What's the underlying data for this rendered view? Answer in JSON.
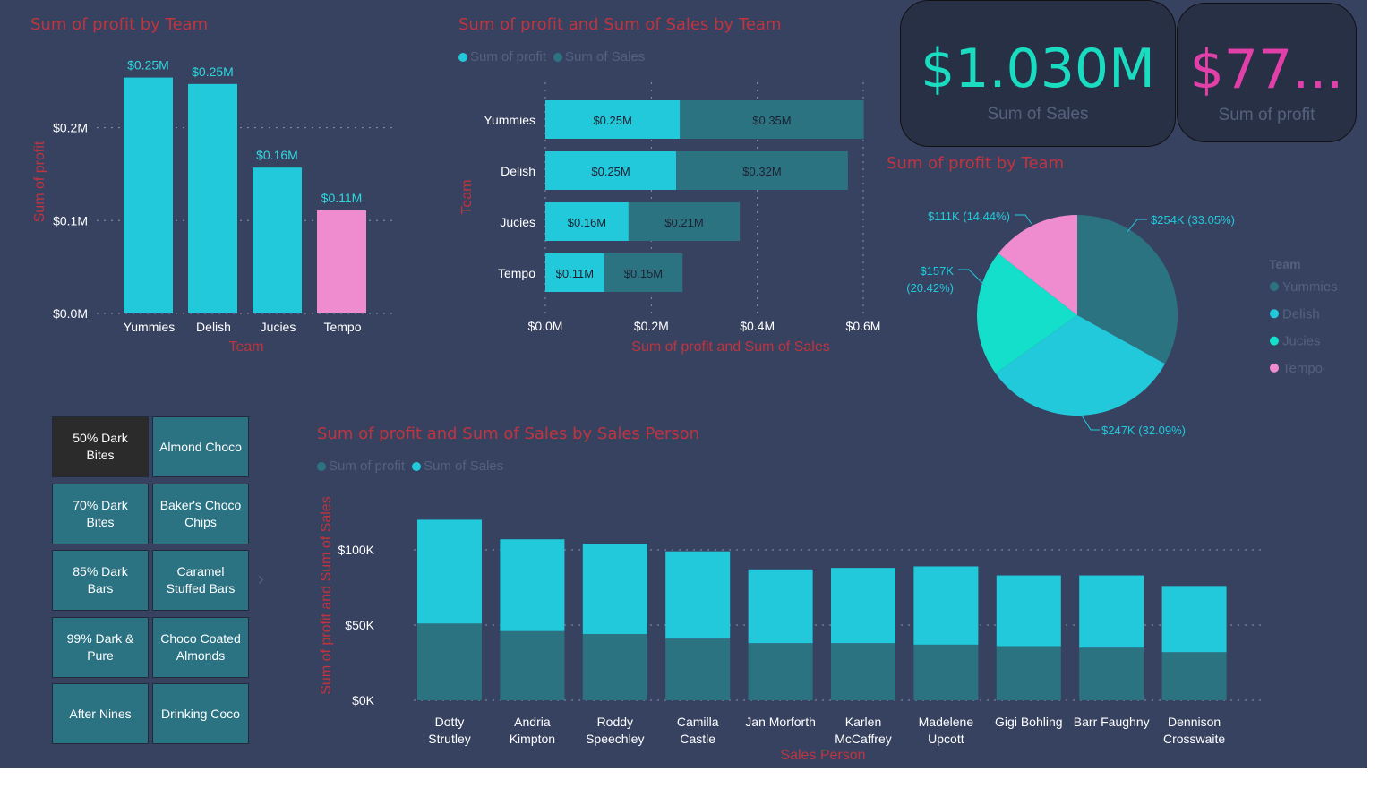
{
  "colors": {
    "cyan": "#22c9db",
    "teal": "#2c7382",
    "aqua": "#14dfcb",
    "pink": "#ee8ccf",
    "title": "#c0343f",
    "muted": "#55617c"
  },
  "cards": {
    "sales": {
      "value": "$1.030M",
      "label": "Sum of Sales",
      "color": "#19dcc0"
    },
    "profit": {
      "value": "$77...",
      "label": "Sum of profit",
      "color": "#e040a8"
    }
  },
  "slicer": {
    "items": [
      "50% Dark Bites",
      "Almond Choco",
      "70% Dark Bites",
      "Baker's Choco Chips",
      "85% Dark Bars",
      "Caramel Stuffed Bars",
      "99% Dark & Pure",
      "Choco Coated Almonds",
      "After Nines",
      "Drinking Coco"
    ],
    "selected": "50% Dark Bites"
  },
  "chart_data": [
    {
      "type": "bar",
      "title": "Sum of profit by Team",
      "xlabel": "Team",
      "ylabel": "Sum of profit",
      "categories": [
        "Yummies",
        "Delish",
        "Jucies",
        "Tempo"
      ],
      "values": [
        0.254,
        0.247,
        0.157,
        0.111
      ],
      "data_labels": [
        "$0.25M",
        "$0.25M",
        "$0.16M",
        "$0.11M"
      ],
      "yticks": [
        "$0.0M",
        "$0.1M",
        "$0.2M"
      ],
      "ylim": [
        0,
        0.27
      ]
    },
    {
      "type": "bar",
      "orientation": "horizontal-stacked",
      "title": "Sum of profit and Sum of Sales by Team",
      "xlabel": "Sum of profit and Sum of Sales",
      "ylabel": "Team",
      "categories": [
        "Yummies",
        "Delish",
        "Jucies",
        "Tempo"
      ],
      "series": [
        {
          "name": "Sum of profit",
          "values": [
            0.254,
            0.247,
            0.157,
            0.111
          ],
          "labels": [
            "$0.25M",
            "$0.25M",
            "$0.16M",
            "$0.11M"
          ]
        },
        {
          "name": "Sum of Sales",
          "values": [
            0.347,
            0.324,
            0.21,
            0.148
          ],
          "labels": [
            "$0.35M",
            "$0.32M",
            "$0.21M",
            "$0.15M"
          ]
        }
      ],
      "xticks": [
        "$0.0M",
        "$0.2M",
        "$0.4M",
        "$0.6M"
      ],
      "xlim": [
        0,
        0.6
      ]
    },
    {
      "type": "pie",
      "title": "Sum of profit by Team",
      "legend_title": "Team",
      "categories": [
        "Yummies",
        "Delish",
        "Jucies",
        "Tempo"
      ],
      "values": [
        33.05,
        32.09,
        20.42,
        14.44
      ],
      "labels": [
        "$254K (33.05%)",
        "$247K (32.09%)",
        "$157K (20.42%)",
        "$111K (14.44%)"
      ]
    },
    {
      "type": "bar",
      "orientation": "vertical-stacked",
      "title": "Sum of profit and Sum of Sales by Sales Person",
      "xlabel": "Sales Person",
      "ylabel": "Sum of profit and Sum of Sales",
      "categories": [
        "Dotty Strutley",
        "Andria Kimpton",
        "Roddy Speechley",
        "Camilla Castle",
        "Jan Morforth",
        "Karlen McCaffrey",
        "Madelene Upcott",
        "Gigi Bohling",
        "Barr Faughny",
        "Dennison Crosswaite"
      ],
      "series": [
        {
          "name": "Sum of profit",
          "values": [
            51,
            46,
            44,
            41,
            38,
            38,
            37,
            36,
            35,
            32
          ]
        },
        {
          "name": "Sum of Sales",
          "values": [
            69,
            61,
            60,
            58,
            49,
            50,
            52,
            47,
            48,
            44
          ]
        }
      ],
      "yticks": [
        "$0K",
        "$50K",
        "$100K"
      ],
      "ylim": [
        0,
        125
      ]
    }
  ]
}
